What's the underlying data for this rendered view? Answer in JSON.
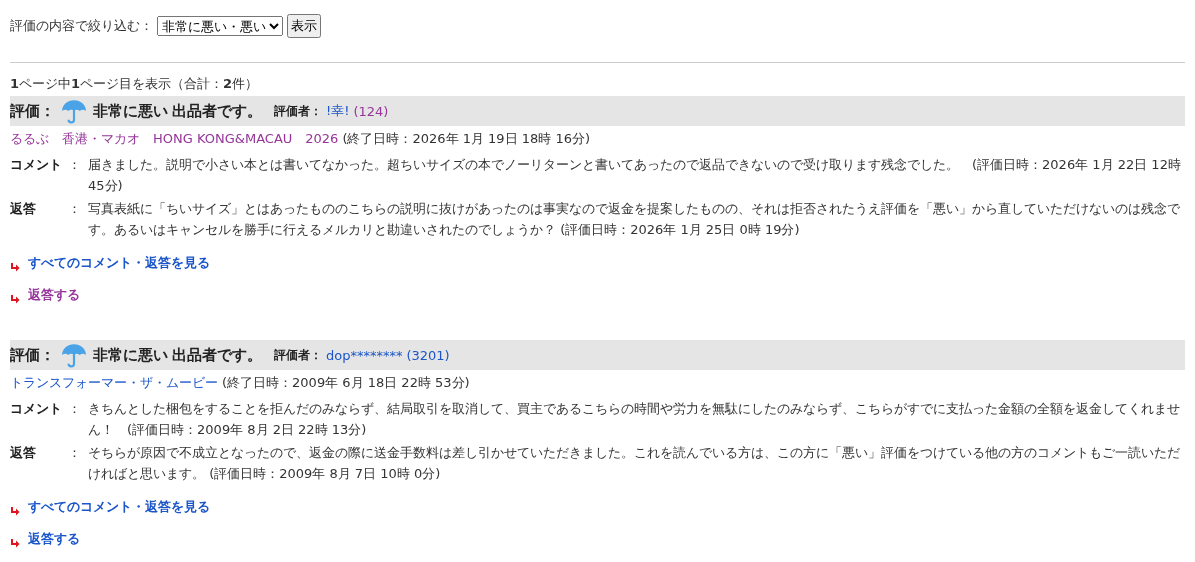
{
  "filter": {
    "label": "評価の内容で絞り込む：",
    "value": "非常に悪い・悪い",
    "button": "表示"
  },
  "pager": "**1**ページ中**1**ページ目を表示（合計：**2**件）",
  "reviews": [
    {
      "label": "評価：",
      "rating": "非常に悪い",
      "role": "出品者です。",
      "rater_label": "評価者：",
      "rater": {
        "text": "!幸!",
        "visited": false
      },
      "rater_count": {
        "text": "(124)",
        "visited": true
      },
      "item": {
        "text": "るるぶ　香港・マカオ　HONG KONG&MACAU　2026",
        "visited": true
      },
      "end_time": "(終了日時：2026年 1月 19日 18時 16分)",
      "fields": [
        {
          "label": "コメント",
          "colon": "：",
          "text": "届きました。説明で小さい本とは書いてなかった。超ちいサイズの本でノーリターンと書いてあったので返品できないので受け取ります残念でした。　(評価日時：2026年 1月 22日 12時 45分)"
        },
        {
          "label": "返答",
          "colon": "：",
          "text": "写真表紙に「ちいサイズ」とはあったもののこちらの説明に抜けがあったのは事実なので返金を提案したものの、それは拒否されたうえ評価を「悪い」から直していただけないのは残念です。あるいはキャンセルを勝手に行えるメルカリと勘違いされたのでしょうか？ (評価日時：2026年 1月 25日 0時 19分)"
        }
      ],
      "links": [
        {
          "text": "すべてのコメント・返答を見る",
          "visited": false
        },
        {
          "text": "返答する",
          "visited": true
        }
      ]
    },
    {
      "label": "評価：",
      "rating": "非常に悪い",
      "role": "出品者です。",
      "rater_label": "評価者：",
      "rater": {
        "text": "dop********",
        "visited": false
      },
      "rater_count": {
        "text": "(3201)",
        "visited": false
      },
      "item": {
        "text": "トランスフォーマー・ザ・ムービー",
        "visited": false
      },
      "end_time": "(終了日時：2009年 6月 18日 22時 53分)",
      "fields": [
        {
          "label": "コメント",
          "colon": "：",
          "text": "きちんとした梱包をすることを拒んだのみならず、結局取引を取消して、買主であるこちらの時間や労力を無駄にしたのみならず、こちらがすでに支払った金額の全額を返金してくれません！　(評価日時：2009年 8月 2日 22時 13分)"
        },
        {
          "label": "返答",
          "colon": "：",
          "text": "そちらが原因で不成立となったので、返金の際に送金手数料は差し引かせていただきました。これを読んでいる方は、この方に「悪い」評価をつけている他の方のコメントもご一読いただければと思います。 (評価日時：2009年 8月 7日 10時 0分)"
        }
      ],
      "links": [
        {
          "text": "すべてのコメント・返答を見る",
          "visited": false
        },
        {
          "text": "返答する",
          "visited": false
        }
      ]
    }
  ]
}
